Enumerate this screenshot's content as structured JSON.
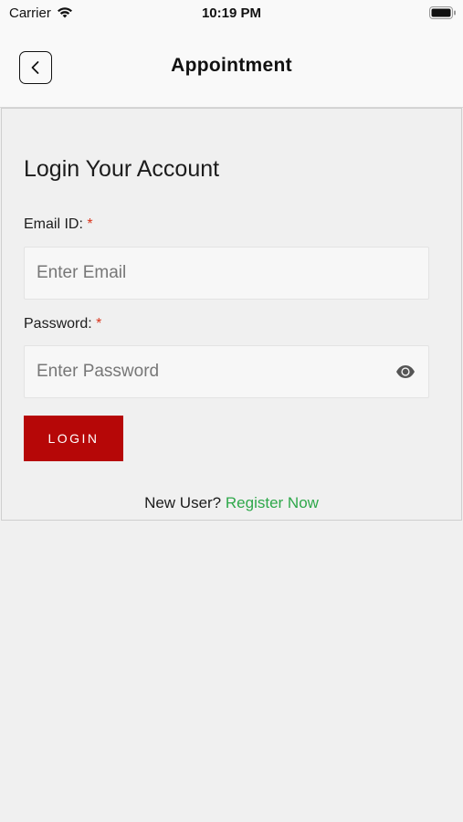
{
  "status_bar": {
    "carrier": "Carrier",
    "time": "10:19 PM",
    "icons": [
      "wifi-icon",
      "battery-icon"
    ]
  },
  "nav": {
    "title": "Appointment",
    "back_icon": "chevron-left-icon"
  },
  "login": {
    "heading": "Login Your Account",
    "email_label": "Email ID:",
    "email_required": "*",
    "email_placeholder": "Enter Email",
    "email_value": "",
    "password_label": "Password:",
    "password_required": "*",
    "password_placeholder": "Enter Password",
    "password_value": "",
    "password_toggle_icon": "eye-icon",
    "login_button": "LOGIN",
    "new_user_text": "New User?",
    "register_link": "Register Now"
  },
  "colors": {
    "primary_button": "#b60707",
    "link": "#2ea84a",
    "required": "#d9331a",
    "background": "#f0f0f0"
  }
}
